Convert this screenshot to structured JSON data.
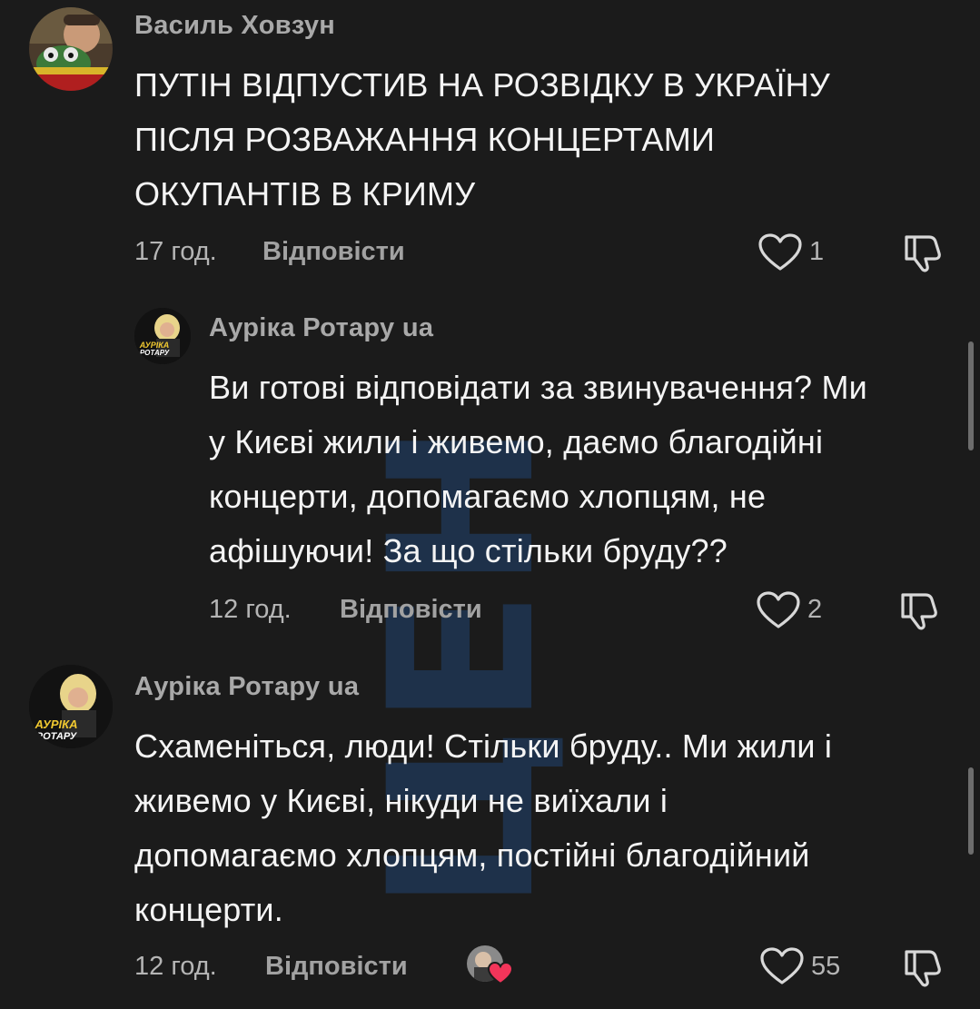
{
  "watermark": {
    "text": "СЦЕНА",
    "color": "#1f3552"
  },
  "colors": {
    "background": "#1b1b1b",
    "author": "#a9a9a9",
    "text": "#f4f4f4",
    "meta": "#b5b5b5",
    "reply": "#a2a2a2"
  },
  "comments": [
    {
      "author": "Василь Ховзун",
      "lines": [
        "ПУТІН ВІДПУСТИВ НА РОЗВІДКУ В УКРАЇНУ",
        "ПІСЛЯ РОЗВАЖАННЯ КОНЦЕРТАМИ",
        "ОКУПАНТІВ В КРИМУ"
      ],
      "time": "17 год.",
      "reply_label": "Відповісти",
      "likes": "1"
    },
    {
      "author": "Аурiка Ротару ua",
      "avatar_text": [
        "АУРІКА",
        "РОТАРУ"
      ],
      "lines": [
        "Ви готові відповідати за звинувачення? Ми",
        "у Києві жили і живемо, даємо благодійні",
        "концерти, допомагаємо хлопцям, не",
        "афішуючи! За що стільки бруду??"
      ],
      "time": "12 год.",
      "reply_label": "Відповісти",
      "likes": "2"
    },
    {
      "author": "Аурiка Ротару ua",
      "avatar_text": [
        "АУРІКА",
        "РОТАРУ"
      ],
      "lines": [
        "Схаменіться, люди! Стільки бруду.. Ми жили і",
        "живемо у Києві, нікуди не виїхали і",
        "допомагаємо хлопцям, постійні благодійний",
        "концерти."
      ],
      "time": "12 год.",
      "reply_label": "Відповісти",
      "likes": "55"
    }
  ]
}
